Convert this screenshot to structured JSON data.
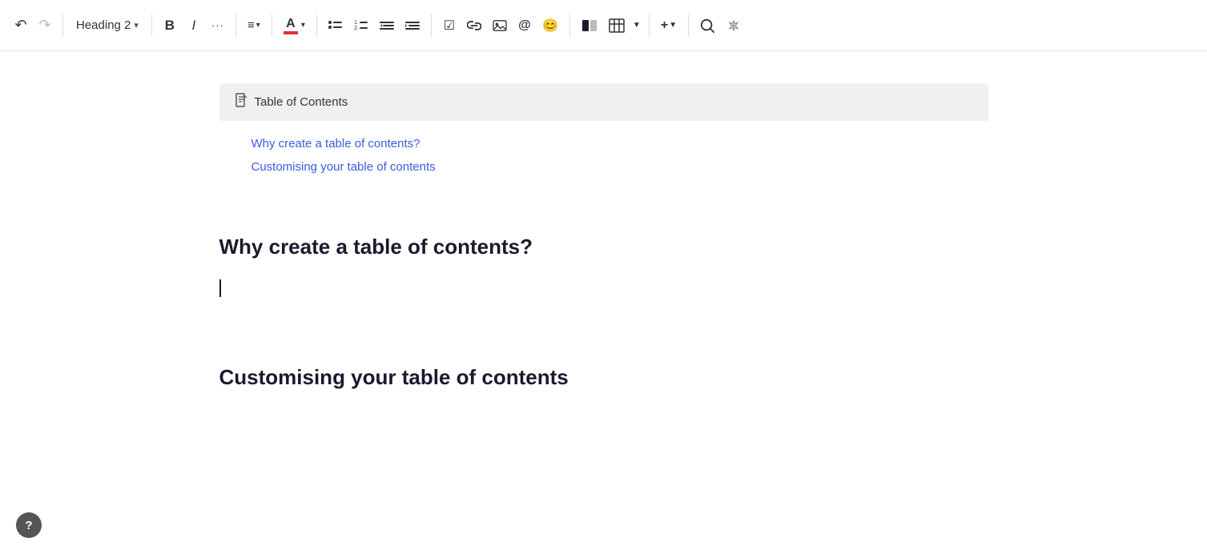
{
  "toolbar": {
    "undo_label": "↺",
    "redo_label": "↻",
    "heading_selector_label": "Heading 2",
    "chevron": "▾",
    "bold_label": "B",
    "italic_label": "I",
    "more_label": "•••",
    "align_label": "≡",
    "color_letter": "A",
    "color_bar_color": "#e03131",
    "color_dropdown": "▾",
    "list_bullet": "≡",
    "list_ordered": "≡",
    "list_indent_out": "≡",
    "list_indent_in": "≡",
    "checkbox_label": "☑",
    "link_label": "🔗",
    "image_label": "🖼",
    "mention_label": "@",
    "emoji_label": "😊",
    "columns_label": "▐▌",
    "table_label": "⊞",
    "table_chevron": "▾",
    "insert_label": "+",
    "insert_chevron": "▾",
    "search_label": "🔍",
    "ai_label": "✳"
  },
  "toc": {
    "icon": "📄",
    "title": "Table of Contents",
    "link1": "Why create a table of contents?",
    "link2": "Customising your table of contents"
  },
  "section1": {
    "heading": "Why create a table of contents?",
    "paragraph": ""
  },
  "section2": {
    "heading": "Customising your table of contents"
  },
  "help": {
    "label": "?"
  }
}
